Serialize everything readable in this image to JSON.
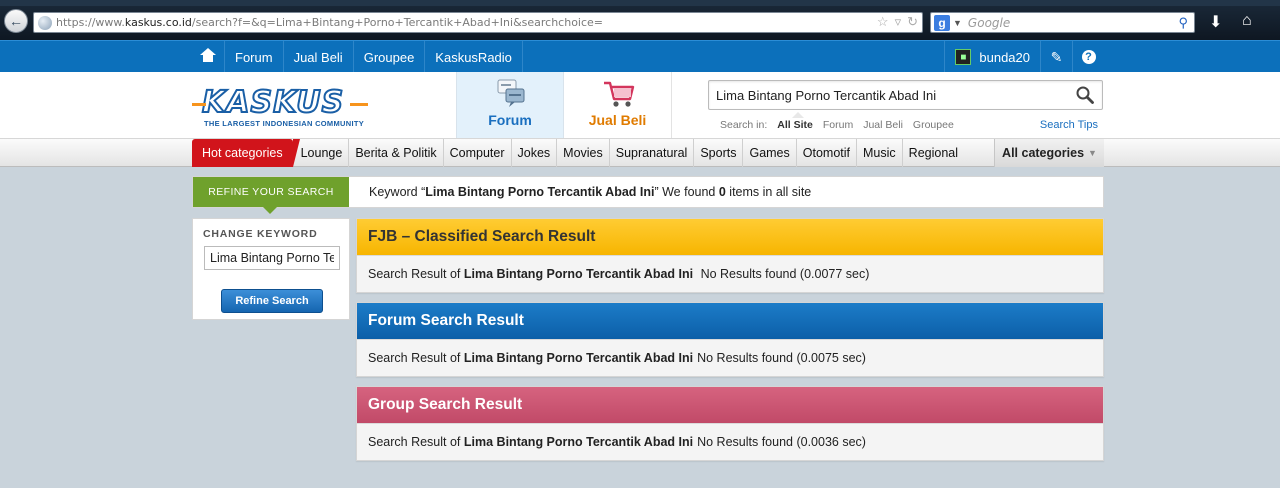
{
  "browser": {
    "url_prefix": "https://www.",
    "url_domain": "kaskus.co.id",
    "url_rest": "/search?f=&q=Lima+Bintang+Porno+Tercantik+Abad+Ini&searchchoice=",
    "search_placeholder": "Google"
  },
  "topnav": {
    "items": [
      "Forum",
      "Jual Beli",
      "Groupee",
      "KaskusRadio"
    ],
    "username": "bunda20"
  },
  "header": {
    "logo_text": "KASKUS",
    "logo_tagline": "THE LARGEST INDONESIAN COMMUNITY",
    "tab_forum": "Forum",
    "tab_jualbeli": "Jual Beli",
    "search_value": "Lima Bintang Porno Tercantik Abad Ini",
    "search_in_label": "Search in:",
    "search_in_options": [
      "All Site",
      "Forum",
      "Jual Beli",
      "Groupee"
    ],
    "search_tips": "Search Tips"
  },
  "catbar": {
    "hot": "Hot categories",
    "items": [
      "Lounge",
      "Berita & Politik",
      "Computer",
      "Jokes",
      "Movies",
      "Supranatural",
      "Sports",
      "Games",
      "Otomotif",
      "Music",
      "Regional"
    ],
    "all": "All categories"
  },
  "refine": {
    "label": "Refine your search",
    "msg_prefix": "Keyword “",
    "keyword": "Lima Bintang Porno Tercantik Abad Ini",
    "msg_mid": "” We found ",
    "count": "0",
    "msg_suffix": " items in all site"
  },
  "sidebar": {
    "label": "Change Keyword",
    "input_value": "Lima Bintang Porno Tercantik Abad Ini",
    "button": "Refine Search"
  },
  "results": {
    "prefix": "Search Result of ",
    "keyword": "Lima Bintang Porno Tercantik Abad Ini",
    "fjb": {
      "title": "FJB – Classified Search Result",
      "status": "No Results found (0.0077 sec)"
    },
    "forum": {
      "title": "Forum Search Result",
      "status": "No Results found (0.0075 sec)"
    },
    "group": {
      "title": "Group Search Result",
      "status": "No Results found (0.0036 sec)"
    }
  },
  "colors": {
    "brand_blue": "#0c70bb",
    "hot_red": "#d1141b",
    "refine_green": "#6fa12c",
    "fjb_yellow": "#f7b500",
    "forum_blue": "#0c5fa8",
    "group_pink": "#c14a68",
    "jualbeli_orange": "#e07b00"
  }
}
